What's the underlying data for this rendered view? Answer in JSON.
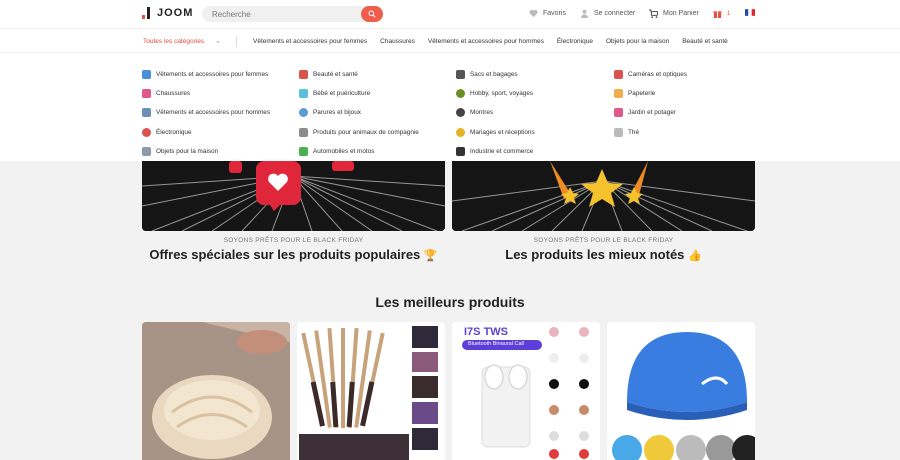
{
  "header": {
    "logo_text": "JOOM",
    "search_placeholder": "Recherche",
    "favorites": "Favoris",
    "login": "Se connecter",
    "cart": "Mon Panier",
    "notif_count": "1"
  },
  "catbar": {
    "all_label": "Toutes les catégories",
    "links": [
      "Vêtements et accessoires pour femmes",
      "Chaussures",
      "Vêtements et accessoires pour hommes",
      "Électronique",
      "Objets pour la maison",
      "Beauté et santé"
    ]
  },
  "mega_menu": {
    "columns": [
      [
        {
          "label": "Vêtements et accessoires pour femmes",
          "icon": "dress-icon",
          "color": "#4a90d9"
        },
        {
          "label": "Chaussures",
          "icon": "shoe-icon",
          "color": "#e0578a"
        },
        {
          "label": "Vêtements et accessoires pour hommes",
          "icon": "shirt-icon",
          "color": "#6c8fb7"
        },
        {
          "label": "Électronique",
          "icon": "headphones-icon",
          "color": "#d9534f"
        },
        {
          "label": "Objets pour la maison",
          "icon": "home-icon",
          "color": "#8a9aa8"
        }
      ],
      [
        {
          "label": "Beauté et santé",
          "icon": "lipstick-icon",
          "color": "#d9534f"
        },
        {
          "label": "Bébé et puériculture",
          "icon": "bottle-icon",
          "color": "#5bc0de"
        },
        {
          "label": "Parures et bijoux",
          "icon": "ring-icon",
          "color": "#5a9bd5"
        },
        {
          "label": "Produits pour animaux de compagnie",
          "icon": "dog-icon",
          "color": "#8c8c8c"
        },
        {
          "label": "Automobiles et motos",
          "icon": "car-icon",
          "color": "#4caf50"
        }
      ],
      [
        {
          "label": "Sacs et bagages",
          "icon": "bag-icon",
          "color": "#555555"
        },
        {
          "label": "Hobby, sport, voyages",
          "icon": "bike-icon",
          "color": "#6b8e23"
        },
        {
          "label": "Montres",
          "icon": "watch-icon",
          "color": "#444444"
        },
        {
          "label": "Mariages et réceptions",
          "icon": "rings-icon",
          "color": "#e6b422"
        },
        {
          "label": "Industrie et commerce",
          "icon": "factory-icon",
          "color": "#333333"
        }
      ],
      [
        {
          "label": "Caméras et optiques",
          "icon": "camera-icon",
          "color": "#d9534f"
        },
        {
          "label": "Papeterie",
          "icon": "pencil-icon",
          "color": "#f0ad4e"
        },
        {
          "label": "Jardin et potager",
          "icon": "plant-icon",
          "color": "#e0578a"
        },
        {
          "label": "Thé",
          "icon": "tea-icon",
          "color": "#bbbbbb"
        }
      ]
    ]
  },
  "promos": [
    {
      "subtitle": "SOYONS PRÊTS POUR LE BLACK FRIDAY",
      "title": "Offres spéciales sur les produits populaires",
      "emoji": "🏆"
    },
    {
      "subtitle": "SOYONS PRÊTS POUR LE BLACK FRIDAY",
      "title": "Les produits les mieux notés",
      "emoji": "👍"
    }
  ],
  "section_title": "Les meilleurs produits",
  "products": [
    {
      "name": "bread-product-image"
    },
    {
      "name": "makeup-brushes-product-image"
    },
    {
      "name": "earbuds-product-image",
      "badge": "I7S TWS",
      "subbadge": "Bluetooth Binaural Call"
    },
    {
      "name": "swim-cap-product-image"
    }
  ],
  "colors": {
    "accent": "#f05d4d",
    "brand_red": "#e94b3c"
  }
}
